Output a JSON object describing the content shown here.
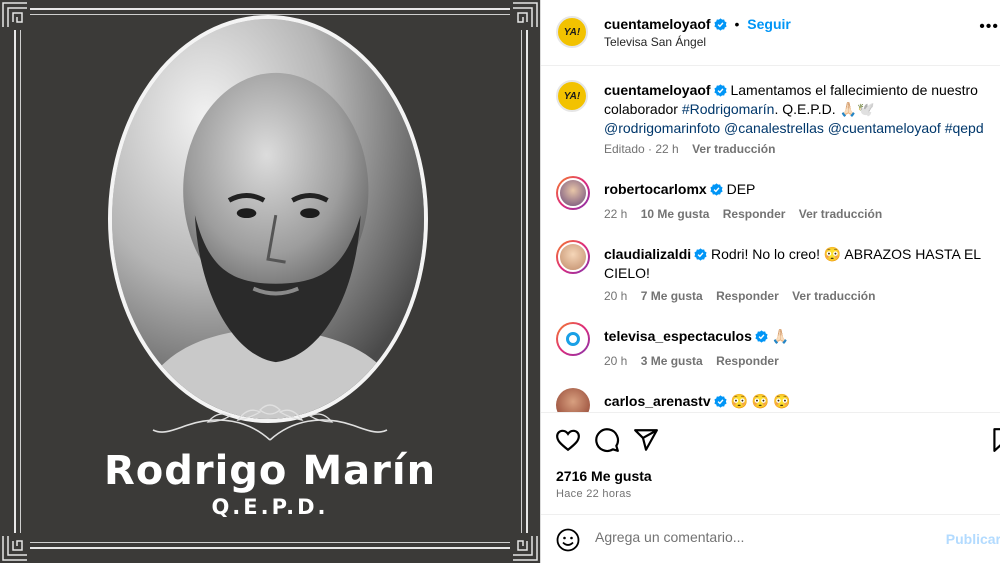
{
  "memorial": {
    "name": "Rodrigo Marín",
    "subtitle": "Q.E.P.D."
  },
  "post": {
    "author": "cuentameloyaof",
    "follow_separator": "•",
    "follow_label": "Seguir",
    "location": "Televisa San Ángel",
    "avatar_text": "YA!",
    "more_icon": "more-horizontal-icon",
    "verified_color": "#0095f6"
  },
  "caption": {
    "author": "cuentameloyaof",
    "text_1": "Lamentamos el fallecimiento de nuestro colaborador",
    "hashtag_1": "#Rodrigomarín",
    "text_2": ". Q.E.P.D. 🙏🏻🕊️",
    "mention_1": "@rodrigomarinfoto",
    "mention_2": "@canalestrellas",
    "mention_3": "@cuentameloyaof",
    "hashtag_2": "#qepd",
    "meta_edited": "Editado · 22 h",
    "meta_translate": "Ver traducción"
  },
  "comments": [
    {
      "user": "robertocarlomx",
      "text": "DEP",
      "time": "22 h",
      "likes": "10 Me gusta",
      "reply": "Responder",
      "translate": "Ver traducción"
    },
    {
      "user": "claudializaldi",
      "text": "Rodri! No lo creo! 😳 ABRAZOS HASTA EL CIELO!",
      "time": "20 h",
      "likes": "7 Me gusta",
      "reply": "Responder",
      "translate": "Ver traducción"
    },
    {
      "user": "televisa_espectaculos",
      "text": "🙏🏻",
      "time": "20 h",
      "likes": "3 Me gusta",
      "reply": "Responder"
    },
    {
      "user": "carlos_arenastv",
      "text": "😳 😳 😳"
    }
  ],
  "actions": {
    "like_icon": "heart-icon",
    "comment_icon": "comment-icon",
    "share_icon": "share-icon",
    "save_icon": "bookmark-icon"
  },
  "likes_count": "2716 Me gusta",
  "time_ago": "Hace 22 horas",
  "add_comment": {
    "placeholder": "Agrega un comentario...",
    "publish_label": "Publicar",
    "emoji_icon": "emoji-icon"
  }
}
